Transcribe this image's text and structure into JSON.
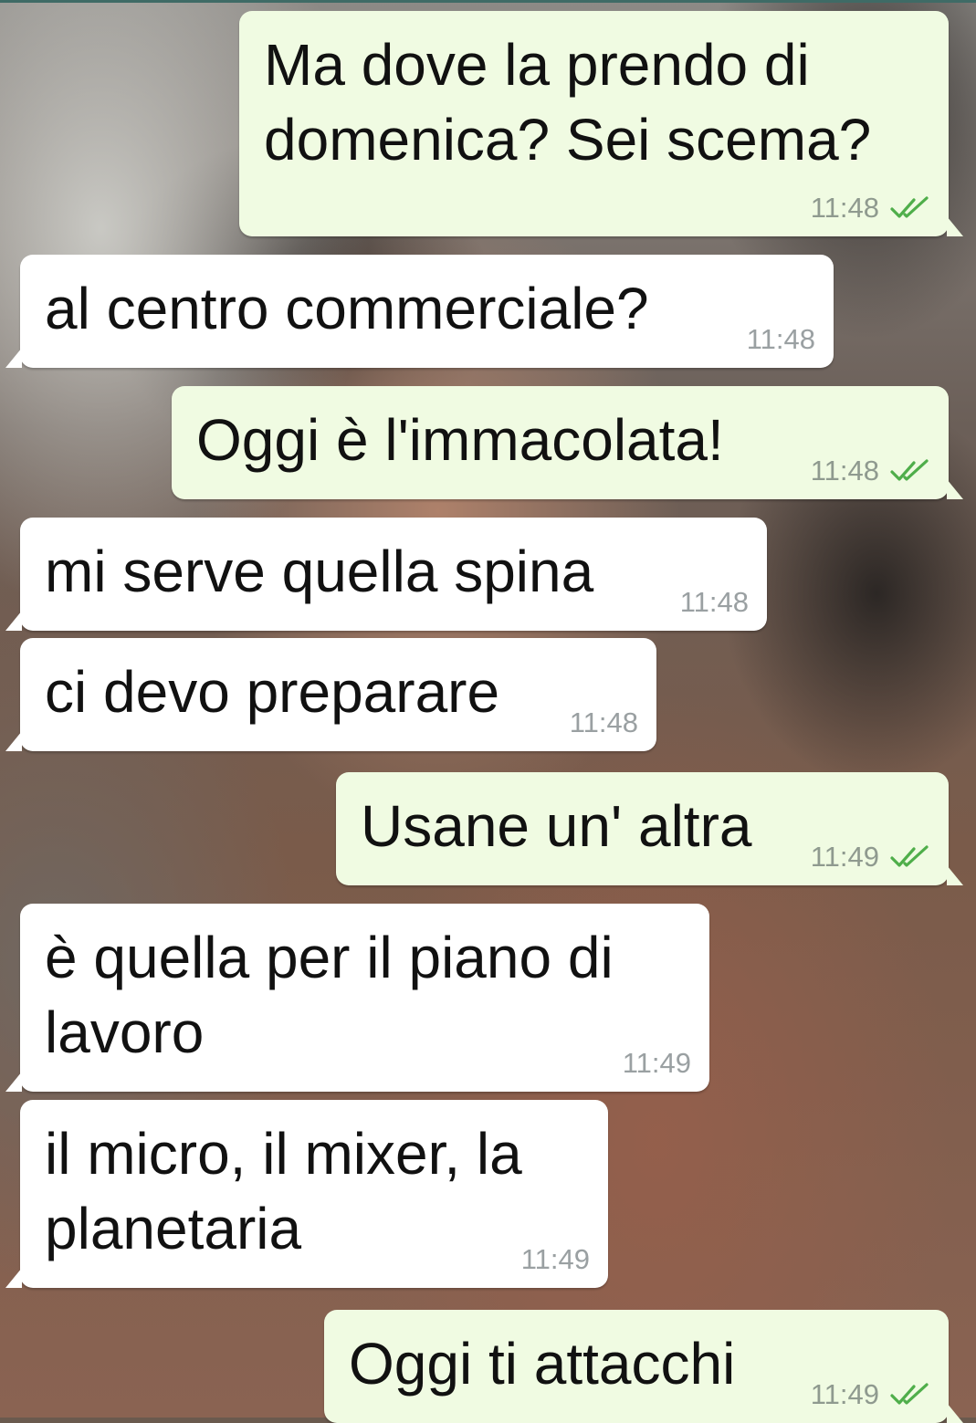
{
  "colors": {
    "incoming_bg": "#ffffff",
    "outgoing_bg": "#f0fbe2",
    "time": "#8f9a8f",
    "read_ticks": "#4fae4a"
  },
  "messages": [
    {
      "text": "Ma dove la prendo di\ndomenica? Sei scema?",
      "time": "11:48",
      "direction": "out",
      "status": "read"
    },
    {
      "text": "al centro commerciale?",
      "time": "11:48",
      "direction": "in"
    },
    {
      "text": "Oggi è l'immacolata!",
      "time": "11:48",
      "direction": "out",
      "status": "read"
    },
    {
      "text": "mi serve quella spina",
      "time": "11:48",
      "direction": "in"
    },
    {
      "text": "ci devo preparare",
      "time": "11:48",
      "direction": "in"
    },
    {
      "text": "Usane un' altra",
      "time": "11:49",
      "direction": "out",
      "status": "read"
    },
    {
      "text": "è quella per il piano di\nlavoro",
      "time": "11:49",
      "direction": "in"
    },
    {
      "text": "il micro, il mixer, la\nplanetaria",
      "time": "11:49",
      "direction": "in"
    },
    {
      "text": "Oggi ti attacchi",
      "time": "11:49",
      "direction": "out",
      "status": "read"
    }
  ]
}
